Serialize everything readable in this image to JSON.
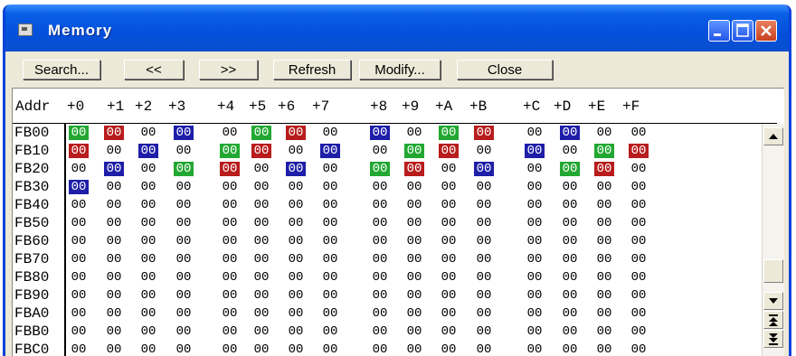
{
  "window": {
    "title": "Memory",
    "buttons": [
      "minimize",
      "maximize",
      "close"
    ]
  },
  "toolbar": {
    "search_label": "Search...",
    "prev_label": "<<",
    "next_label": ">>",
    "refresh_label": "Refresh",
    "modify_label": "Modify...",
    "close_label": "Close"
  },
  "memory": {
    "addr_header": "Addr",
    "column_headers": [
      "+0",
      "+1",
      "+2",
      "+3",
      "+4",
      "+5",
      "+6",
      "+7",
      "+8",
      "+9",
      "+A",
      "+B",
      "+C",
      "+D",
      "+E",
      "+F"
    ],
    "highlight_colors": {
      "g": "#22a832",
      "r": "#b81c1c",
      "b": "#1e1ea8"
    },
    "rows": [
      {
        "addr": "FB00",
        "values": [
          "00",
          "00",
          "00",
          "00",
          "00",
          "00",
          "00",
          "00",
          "00",
          "00",
          "00",
          "00",
          "00",
          "00",
          "00",
          "00"
        ],
        "hl": [
          "g",
          "r",
          "",
          "b",
          "",
          "g",
          "r",
          "",
          "b",
          "",
          "g",
          "r",
          "",
          "b",
          "",
          ""
        ]
      },
      {
        "addr": "FB10",
        "values": [
          "00",
          "00",
          "00",
          "00",
          "00",
          "00",
          "00",
          "00",
          "00",
          "00",
          "00",
          "00",
          "00",
          "00",
          "00",
          "00"
        ],
        "hl": [
          "r",
          "",
          "b",
          "",
          "g",
          "r",
          "",
          "b",
          "",
          "g",
          "r",
          "",
          "b",
          "",
          "g",
          "r"
        ]
      },
      {
        "addr": "FB20",
        "values": [
          "00",
          "00",
          "00",
          "00",
          "00",
          "00",
          "00",
          "00",
          "00",
          "00",
          "00",
          "00",
          "00",
          "00",
          "00",
          "00"
        ],
        "hl": [
          "",
          "b",
          "",
          "g",
          "r",
          "",
          "b",
          "",
          "g",
          "r",
          "",
          "b",
          "",
          "g",
          "r",
          ""
        ]
      },
      {
        "addr": "FB30",
        "values": [
          "00",
          "00",
          "00",
          "00",
          "00",
          "00",
          "00",
          "00",
          "00",
          "00",
          "00",
          "00",
          "00",
          "00",
          "00",
          "00"
        ],
        "hl": [
          "b",
          "",
          "",
          "",
          "",
          "",
          "",
          "",
          "",
          "",
          "",
          "",
          "",
          "",
          "",
          ""
        ]
      },
      {
        "addr": "FB40",
        "values": [
          "00",
          "00",
          "00",
          "00",
          "00",
          "00",
          "00",
          "00",
          "00",
          "00",
          "00",
          "00",
          "00",
          "00",
          "00",
          "00"
        ],
        "hl": []
      },
      {
        "addr": "FB50",
        "values": [
          "00",
          "00",
          "00",
          "00",
          "00",
          "00",
          "00",
          "00",
          "00",
          "00",
          "00",
          "00",
          "00",
          "00",
          "00",
          "00"
        ],
        "hl": []
      },
      {
        "addr": "FB60",
        "values": [
          "00",
          "00",
          "00",
          "00",
          "00",
          "00",
          "00",
          "00",
          "00",
          "00",
          "00",
          "00",
          "00",
          "00",
          "00",
          "00"
        ],
        "hl": []
      },
      {
        "addr": "FB70",
        "values": [
          "00",
          "00",
          "00",
          "00",
          "00",
          "00",
          "00",
          "00",
          "00",
          "00",
          "00",
          "00",
          "00",
          "00",
          "00",
          "00"
        ],
        "hl": []
      },
      {
        "addr": "FB80",
        "values": [
          "00",
          "00",
          "00",
          "00",
          "00",
          "00",
          "00",
          "00",
          "00",
          "00",
          "00",
          "00",
          "00",
          "00",
          "00",
          "00"
        ],
        "hl": []
      },
      {
        "addr": "FB90",
        "values": [
          "00",
          "00",
          "00",
          "00",
          "00",
          "00",
          "00",
          "00",
          "00",
          "00",
          "00",
          "00",
          "00",
          "00",
          "00",
          "00"
        ],
        "hl": []
      },
      {
        "addr": "FBA0",
        "values": [
          "00",
          "00",
          "00",
          "00",
          "00",
          "00",
          "00",
          "00",
          "00",
          "00",
          "00",
          "00",
          "00",
          "00",
          "00",
          "00"
        ],
        "hl": []
      },
      {
        "addr": "FBB0",
        "values": [
          "00",
          "00",
          "00",
          "00",
          "00",
          "00",
          "00",
          "00",
          "00",
          "00",
          "00",
          "00",
          "00",
          "00",
          "00",
          "00"
        ],
        "hl": []
      },
      {
        "addr": "FBC0",
        "values": [
          "00",
          "00",
          "00",
          "00",
          "00",
          "00",
          "00",
          "00",
          "00",
          "00",
          "00",
          "00",
          "00",
          "00",
          "00",
          "00"
        ],
        "hl": []
      }
    ]
  },
  "scrollbar": {
    "icons": [
      "arrow-up-icon",
      "arrow-down-icon",
      "page-up-icon",
      "page-down-icon"
    ]
  }
}
